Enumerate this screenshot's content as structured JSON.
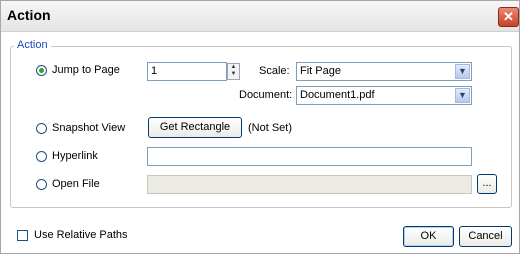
{
  "window": {
    "title": "Action",
    "close_icon": "close-icon"
  },
  "group": {
    "legend": "Action"
  },
  "jump": {
    "label": "Jump to Page",
    "page_value": "1",
    "selected": true
  },
  "scale": {
    "label": "Scale:",
    "value": "Fit Page"
  },
  "document": {
    "label": "Document:",
    "value": "Document1.pdf"
  },
  "snapshot": {
    "label": "Snapshot View",
    "button": "Get Rectangle",
    "status": "(Not Set)"
  },
  "hyperlink": {
    "label": "Hyperlink",
    "value": ""
  },
  "open_file": {
    "label": "Open File",
    "value": "",
    "browse": "..."
  },
  "footer": {
    "relative_paths": "Use Relative Paths",
    "ok": "OK",
    "cancel": "Cancel"
  }
}
